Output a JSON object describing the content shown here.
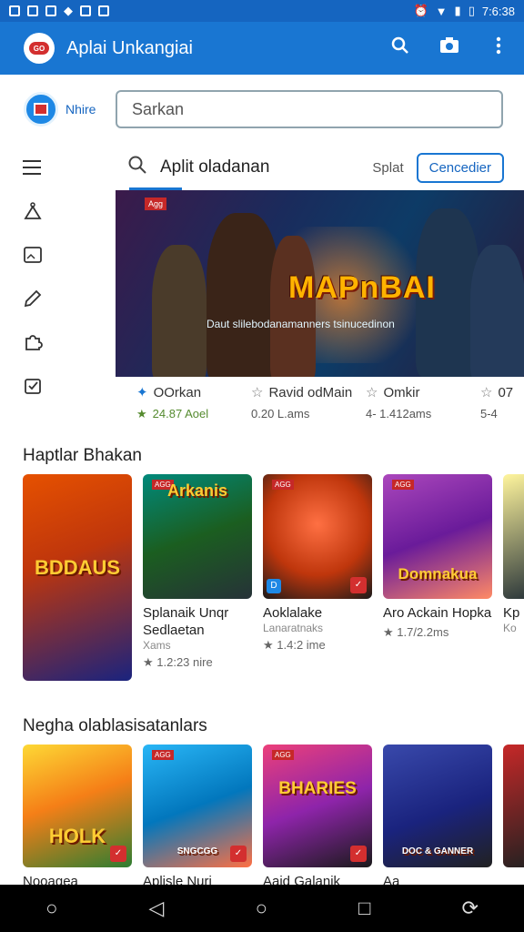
{
  "status": {
    "time": "7:6:38",
    "left_icons": [
      "app-a",
      "app-b",
      "app-c",
      "app-d",
      "app-e",
      "app-f"
    ]
  },
  "appbar": {
    "title": "Aplai Unkangiai",
    "logo_text": "GO"
  },
  "profile": {
    "name": "Nhire",
    "search_placeholder": "Sarkan"
  },
  "subbar": {
    "query": "Aplit oladanan",
    "sort": "Splat",
    "button": "Cencedier"
  },
  "hero": {
    "title": "MAPnBAI",
    "subtitle": "Daut slilebodanamanners tsinucedinon",
    "badge": "Agg"
  },
  "meta": [
    {
      "title": "OOrkan",
      "sub": "24.87 Aoel"
    },
    {
      "title": "Ravid odMain",
      "sub": "0.20 L.ams"
    },
    {
      "title": "Omkir",
      "sub": "4- 1.412ams"
    },
    {
      "title": "07",
      "sub": "5-4"
    }
  ],
  "section1": {
    "title": "Haptlar Bhakan"
  },
  "row1": [
    {
      "art_title": "BDDAUS",
      "name": "Splanaik Unqr Sedlaetan",
      "small": "Xams",
      "rating": "★ 1.2:23 nire"
    },
    {
      "art_title": "Arkanis",
      "name": "Aoklalake",
      "small": "Lanaratnaks",
      "rating": "★ 1.4:2 ime"
    },
    {
      "art_title": "",
      "name": "Aro Ackain Hopka",
      "small": "",
      "rating": "★ 1.7/2.2ms"
    },
    {
      "art_title": "Domnakua",
      "name": "Kp",
      "small": "Ko",
      "rating": ""
    },
    {
      "art_title": "",
      "name": "",
      "small": "",
      "rating": ""
    }
  ],
  "section2": {
    "title": "Negha olablasisatanlars"
  },
  "row2": [
    {
      "art_title": "HOLK",
      "name": "Nooagea"
    },
    {
      "art_title": "SNGCGG",
      "name": "Aplisle Nuri"
    },
    {
      "art_title": "BHARIES",
      "name": "Aaid Galanik"
    },
    {
      "art_title": "DOC & GANNER",
      "name": "Aa"
    },
    {
      "art_title": "",
      "name": ""
    }
  ],
  "colors": {
    "primary": "#1976d2",
    "status": "#1565c0",
    "accent_red": "#d32f2f"
  }
}
